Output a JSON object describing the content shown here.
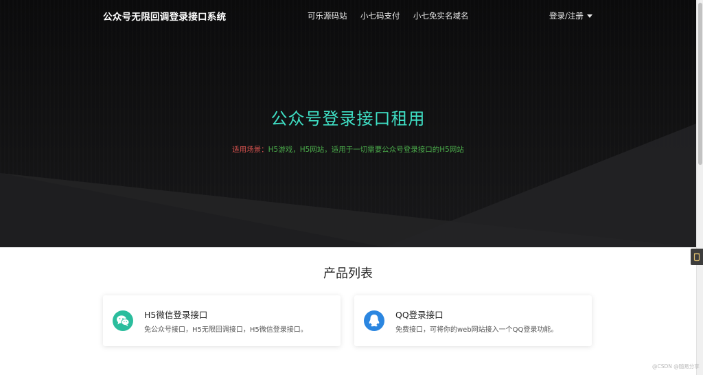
{
  "navbar": {
    "brand": "公众号无限回调登录接口系统",
    "links": [
      "可乐源码站",
      "小七码支付",
      "小七免实名域名"
    ],
    "login": "登录/注册"
  },
  "hero": {
    "title": "公众号登录接口租用",
    "subtitle_label": "适用场景：",
    "subtitle_value": "H5游戏，H5网站，适用于一切需要公众号登录接口的H5网站"
  },
  "products": {
    "title": "产品列表",
    "items": [
      {
        "name": "H5微信登录接口",
        "desc": "免公众号接口，H5无限回调接口，H5微信登录接口。",
        "icon": "wechat-icon",
        "color": "#2bbd9d"
      },
      {
        "name": "QQ登录接口",
        "desc": "免费接口，可将你的web网站接入一个QQ登录功能。",
        "icon": "qq-icon",
        "color": "#2b86e0"
      }
    ]
  },
  "watermark": "@CSDN @随易分享"
}
